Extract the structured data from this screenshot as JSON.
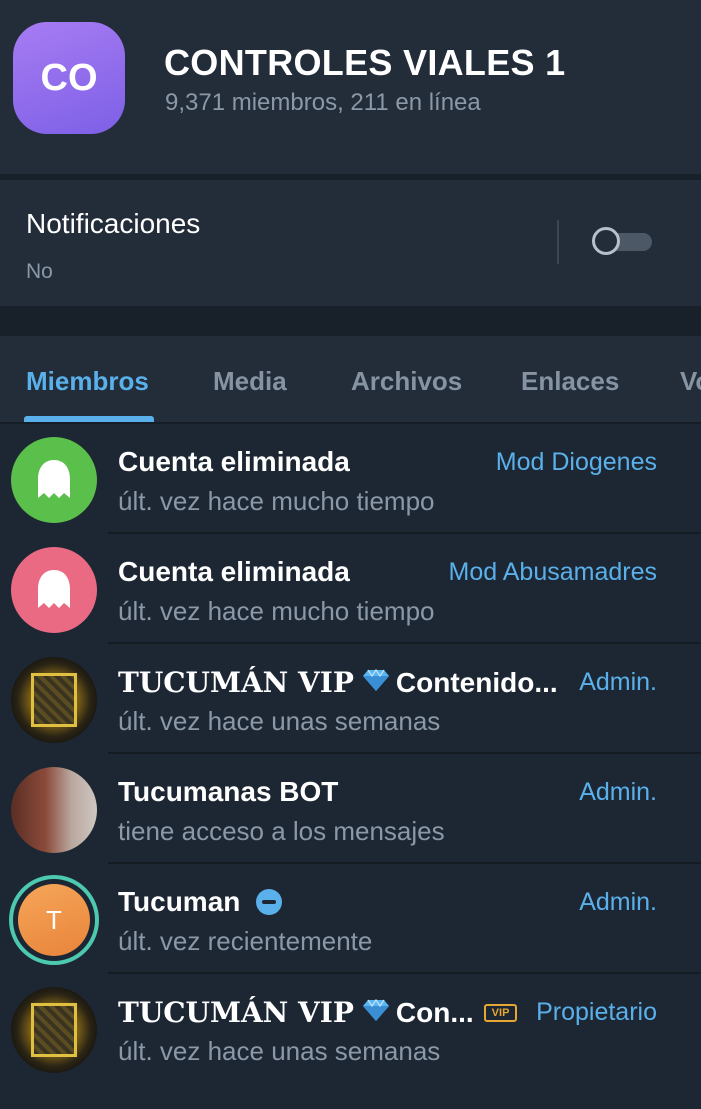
{
  "group": {
    "avatar_initials": "CO",
    "title": "CONTROLES VIALES 1",
    "subtitle": "9,371 miembros, 211 en línea"
  },
  "notifications": {
    "title": "Notificaciones",
    "value": "No",
    "toggle_on": false
  },
  "tabs": [
    {
      "label": "Miembros",
      "active": true
    },
    {
      "label": "Media",
      "active": false
    },
    {
      "label": "Archivos",
      "active": false
    },
    {
      "label": "Enlaces",
      "active": false
    },
    {
      "label": "Vo",
      "active": false
    }
  ],
  "members": [
    {
      "name": "Cuenta eliminada",
      "status": "últ. vez hace mucho tiempo",
      "role": "Mod Diogenes",
      "avatar": "ghost-icon",
      "avatar_color": "#5bbf4b"
    },
    {
      "name": "Cuenta eliminada",
      "status": "últ. vez hace mucho tiempo",
      "role": "Mod Abusamadres",
      "avatar": "ghost-icon",
      "avatar_color": "#ea6a84"
    },
    {
      "name_styled": "TUCUMÁN VIP",
      "name_rest": "Contenido...",
      "status": "últ. vez hace unas semanas",
      "role": "Admin.",
      "avatar": "photo"
    },
    {
      "name": "Tucumanas BOT",
      "status": "tiene acceso a los mensajes",
      "role": "Admin.",
      "avatar": "photo"
    },
    {
      "name": "Tucuman",
      "avatar_initial": "T",
      "status": "últ. vez recientemente",
      "role": "Admin.",
      "avatar": "initial",
      "avatar_color": "#e8843a"
    },
    {
      "name_styled": "TUCUMÁN VIP",
      "name_rest": "Con...",
      "badge": "VIP",
      "status": "últ. vez hace unas semanas",
      "role": "Propietario",
      "avatar": "photo"
    }
  ],
  "colors": {
    "accent": "#5ab0ea",
    "background": "#1d2733",
    "panel": "#222d39",
    "secondary_text": "#8a98a8"
  }
}
